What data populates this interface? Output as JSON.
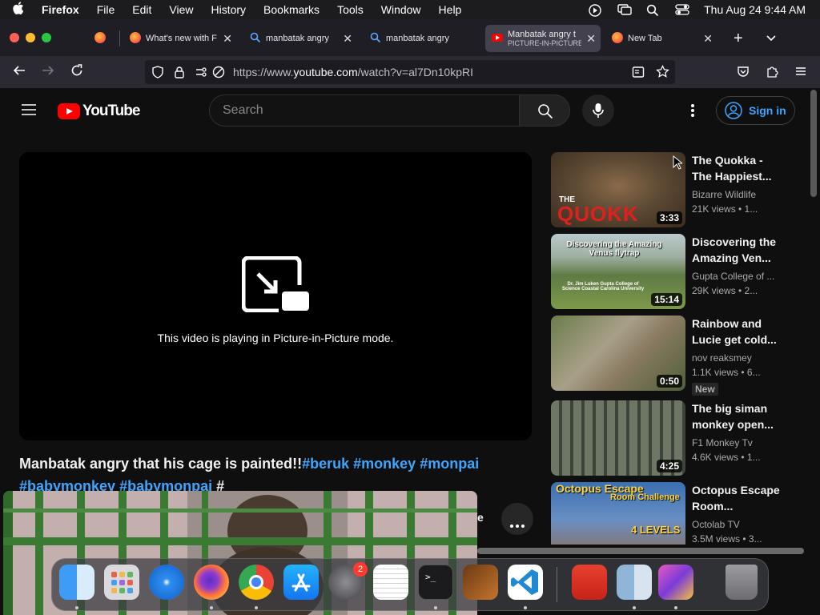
{
  "menubar": {
    "app_name": "Firefox",
    "menus": [
      "File",
      "Edit",
      "View",
      "History",
      "Bookmarks",
      "Tools",
      "Window",
      "Help"
    ],
    "clock": "Thu Aug 24  9:44 AM"
  },
  "tabs": [
    {
      "title": "What's new with F",
      "favicon": "firefox-icon"
    },
    {
      "title": "manbatak angry",
      "favicon": "search-icon"
    },
    {
      "title": "manbatak angry",
      "favicon": "search-icon"
    },
    {
      "title": "Manbatak angry t",
      "subtitle": "PICTURE-IN-PICTURE",
      "favicon": "youtube-icon",
      "active": true
    },
    {
      "title": "New Tab",
      "favicon": "firefox-icon"
    }
  ],
  "urlbar": {
    "prefix": "https://www.",
    "domain": "youtube.com",
    "path": "/watch?v=al7Dn10kpRI"
  },
  "youtube": {
    "logo_text": "YouTube",
    "search_placeholder": "Search",
    "signin_label": "Sign in",
    "pip_message": "This video is playing in Picture-in-Picture mode.",
    "video_title_text": "Manbatak angry that his cage is painted!!",
    "video_title_tags": [
      "#beruk",
      "#monkey",
      "#monpai",
      "#babymonkey",
      "#babymonpai",
      "#"
    ],
    "partial_button_fragment": "e"
  },
  "recommendations": [
    {
      "title": "The Quokka - The Happiest...",
      "channel": "Bizarre Wildlife",
      "views": "21K views • 1...",
      "duration": "3:33",
      "thumb_text": "QUOKK",
      "thumb_text_small": "THE"
    },
    {
      "title": "Discovering the Amazing Ven...",
      "channel": "Gupta College of ...",
      "views": "29K views • 2...",
      "duration": "15:14",
      "thumb_text": "Discovering the Amazing Venus flytrap",
      "thumb_text_small": "Dr. Jim Luken Gupta College of Science Coastal Carolina University"
    },
    {
      "title": "Rainbow and Lucie get cold...",
      "channel": "nov reaksmey",
      "views": "1.1K views • 6...",
      "duration": "0:50",
      "badge": "New"
    },
    {
      "title": "The big siman monkey open...",
      "channel": "F1 Monkey Tv",
      "views": "4.6K views • 1...",
      "duration": "4:25"
    },
    {
      "title": "Octopus Escape Room...",
      "channel": "Octolab TV",
      "views": "3.5M views • 3...",
      "thumb_text": "Octopus Escape",
      "thumb_text_small": "Room Challenge",
      "thumb_text_levels": "4 LEVELS"
    }
  ],
  "dock": {
    "apps": [
      "finder-icon",
      "launchpad-icon",
      "safari-icon",
      "firefox-icon",
      "chrome-icon",
      "app-store-icon",
      "system-settings-icon",
      "textedit-icon",
      "terminal-icon",
      "garageband-icon",
      "vscode-icon",
      "photo-booth-icon",
      "finder-2-icon",
      "game-icon",
      "trash-icon"
    ],
    "settings_badge": "2"
  }
}
